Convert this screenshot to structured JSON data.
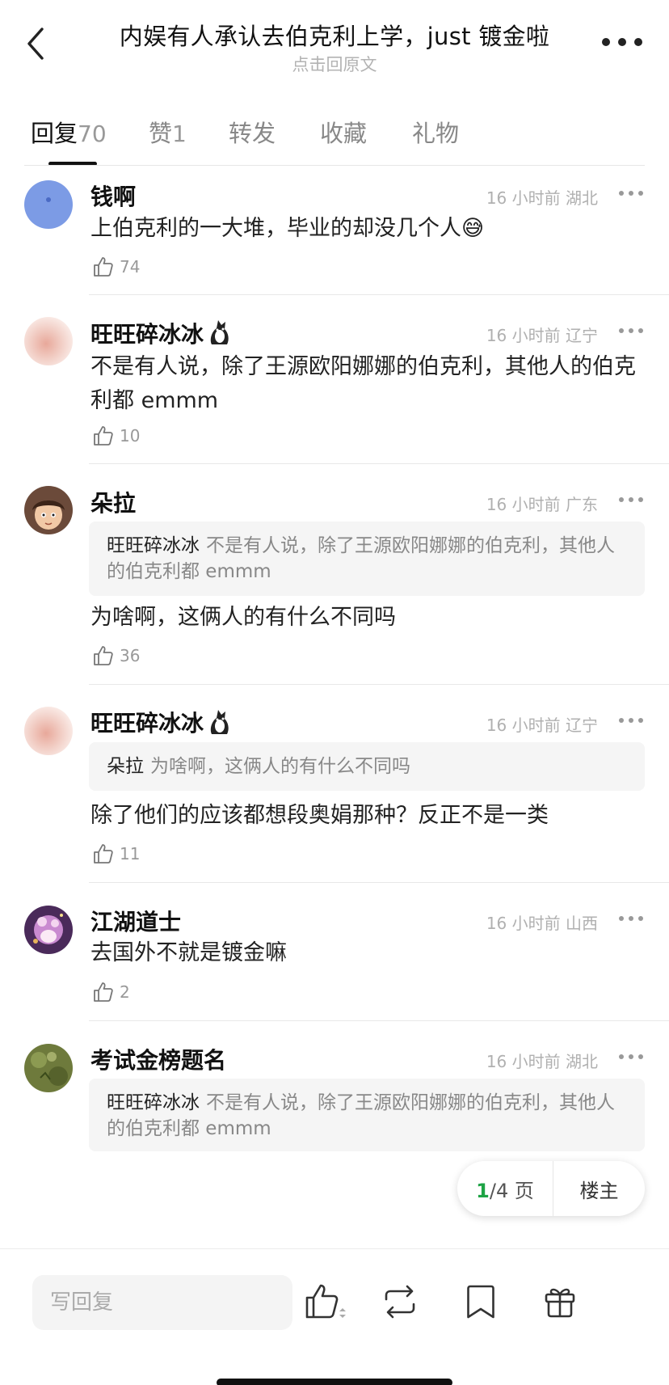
{
  "header": {
    "title": "内娱有人承认去伯克利上学，just 镀金啦",
    "subtitle": "点击回原文"
  },
  "tabs": [
    {
      "label": "回复",
      "count": "70"
    },
    {
      "label": "赞",
      "count": "1"
    },
    {
      "label": "转发",
      "count": ""
    },
    {
      "label": "收藏",
      "count": ""
    },
    {
      "label": "礼物",
      "count": ""
    }
  ],
  "comments": [
    {
      "name": "钱啊",
      "time": "16 小时前",
      "location": "湖北",
      "text": "上伯克利的一大堆，毕业的却没几个人😅",
      "likes": "74"
    },
    {
      "name": "旺旺碎冰冰",
      "time": "16 小时前",
      "location": "辽宁",
      "text": "不是有人说，除了王源欧阳娜娜的伯克利，其他人的伯克利都 emmm",
      "likes": "10"
    },
    {
      "name": "朵拉",
      "time": "16 小时前",
      "location": "广东",
      "quote_name": "旺旺碎冰冰",
      "quote_text": "不是有人说，除了王源欧阳娜娜的伯克利，其他人的伯克利都 emmm",
      "text": "为啥啊，这俩人的有什么不同吗",
      "likes": "36"
    },
    {
      "name": "旺旺碎冰冰",
      "time": "16 小时前",
      "location": "辽宁",
      "quote_name": "朵拉",
      "quote_text": "为啥啊，这俩人的有什么不同吗",
      "text": "除了他们的应该都想段奥娟那种？反正不是一类",
      "likes": "11"
    },
    {
      "name": "江湖道士",
      "time": "16 小时前",
      "location": "山西",
      "text": "去国外不就是镀金嘛",
      "likes": "2"
    },
    {
      "name": "考试金榜题名",
      "time": "16 小时前",
      "location": "湖北",
      "quote_name": "旺旺碎冰冰",
      "quote_text": "不是有人说，除了王源欧阳娜娜的伯克利，其他人的伯克利都 emmm"
    }
  ],
  "pager": {
    "current": "1",
    "total": "/4 页",
    "owner_label": "楼主"
  },
  "bottom_bar": {
    "reply_placeholder": "写回复"
  },
  "colors": {
    "accent_green": "#1ea345",
    "text_gray": "#b0b0b0"
  },
  "icons": [
    "back-icon",
    "more-icon",
    "thumb-up-icon",
    "repost-icon",
    "bookmark-icon",
    "gift-icon"
  ]
}
